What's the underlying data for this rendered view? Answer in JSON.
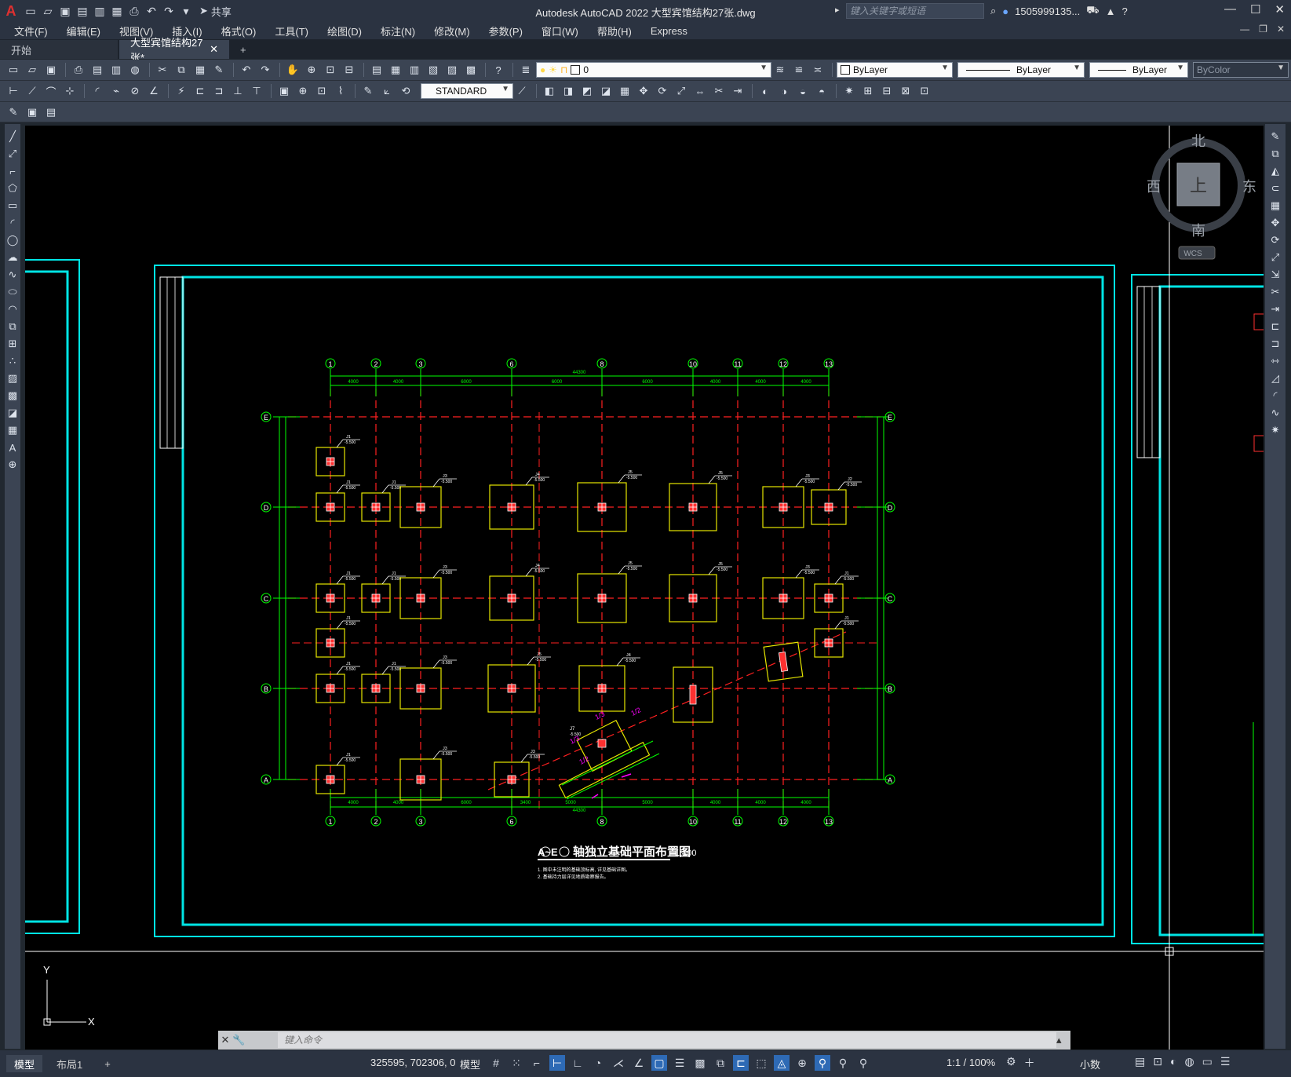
{
  "titlebar": {
    "app_logo": "A",
    "share_label": "共享",
    "window_title": "Autodesk AutoCAD 2022    大型宾馆结构27张.dwg",
    "search_placeholder": "键入关键字或短语",
    "user_name": "1505999135...",
    "help_label": "?"
  },
  "menu": {
    "items": [
      "文件(F)",
      "编辑(E)",
      "视图(V)",
      "插入(I)",
      "格式(O)",
      "工具(T)",
      "绘图(D)",
      "标注(N)",
      "修改(M)",
      "参数(P)",
      "窗口(W)",
      "帮助(H)",
      "Express"
    ]
  },
  "tabs": {
    "start_label": "开始",
    "active_label": "大型宾馆结构27张*",
    "add_label": "+"
  },
  "toolbar": {
    "layer_value": "0",
    "color_value": "ByLayer",
    "linetype_value": "ByLayer",
    "lineweight_value": "ByLayer",
    "plotstyle_value": "ByColor",
    "dimstyle_value": "STANDARD"
  },
  "viewcube": {
    "north": "北",
    "south": "南",
    "east": "东",
    "west": "西",
    "top_face": "上",
    "wcs_label": "WCS"
  },
  "drawing": {
    "grid_labels_top": [
      "1",
      "2",
      "3",
      "6",
      "8",
      "10",
      "11",
      "12",
      "13"
    ],
    "grid_labels_side": [
      "E",
      "D",
      "C",
      "B",
      "A"
    ],
    "top_total_dim": "44300",
    "bottom_total_dim": "44300",
    "top_dims": [
      "4000",
      "4000",
      "6000",
      "6000",
      "6000",
      "4000",
      "4000",
      "4000"
    ],
    "bottom_dims": [
      "4000",
      "4000",
      "6000",
      "3400",
      "5000",
      "5000",
      "4000",
      "4000",
      "4000"
    ],
    "plan_title_prefix": "A~E",
    "plan_title": "轴独立基础平面布置图",
    "plan_scale": "1:100",
    "note_1": "1. 图中未注明的基础顶标高, 详见基础详图。",
    "note_2": "2. 基础持力层详见地质勘察报告。",
    "footing_labels": [
      "J1",
      "J2",
      "J3",
      "J4",
      "J5",
      "J7"
    ],
    "elevation_label": "-5.500",
    "magenta_labels": [
      "1/3",
      "1/2",
      "1/3",
      "1/2"
    ],
    "ucs_y": "Y",
    "ucs_x": "X"
  },
  "cmdline": {
    "placeholder": "键入命令"
  },
  "status": {
    "layout_tabs": [
      "模型",
      "布局1"
    ],
    "add_layout": "+",
    "coords": "325595, 702306, 0",
    "model_label": "模型",
    "scale_label": "1:1 / 100%",
    "units_label": "小数"
  },
  "colors": {
    "background": "#000000",
    "frame": "#00e5e5",
    "grid_line": "#ff2020",
    "dimension": "#00ff00",
    "footing": "#e6e600",
    "column": "#ff3030",
    "annotation": "#ff00ff"
  }
}
